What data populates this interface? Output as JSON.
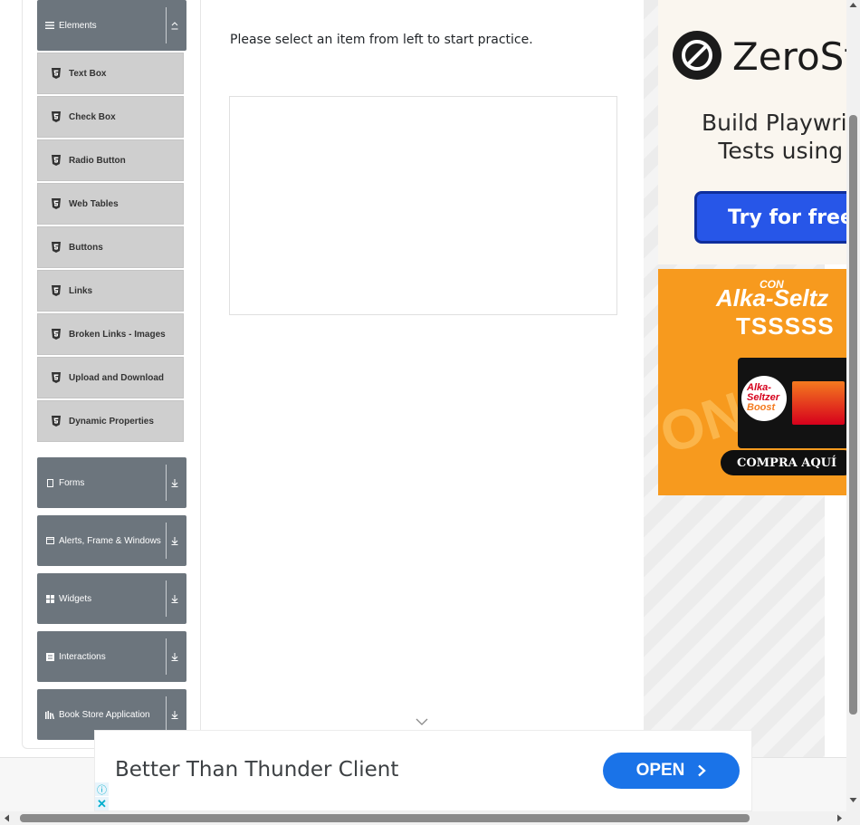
{
  "sidebar": {
    "elements_group": {
      "label": "Elements",
      "icon": "hamburger-icon",
      "arrow": "collapse-arrow-icon"
    },
    "items": [
      {
        "label": "Text Box",
        "icon": "html5-icon"
      },
      {
        "label": "Check Box",
        "icon": "html5-icon"
      },
      {
        "label": "Radio Button",
        "icon": "html5-icon"
      },
      {
        "label": "Web Tables",
        "icon": "html5-icon"
      },
      {
        "label": "Buttons",
        "icon": "html5-icon"
      },
      {
        "label": "Links",
        "icon": "html5-icon"
      },
      {
        "label": "Broken Links - Images",
        "icon": "html5-icon"
      },
      {
        "label": "Upload and Download",
        "icon": "html5-icon"
      },
      {
        "label": "Dynamic Properties",
        "icon": "html5-icon"
      }
    ],
    "groups": [
      {
        "label": "Forms",
        "icon": "document-icon"
      },
      {
        "label": "Alerts, Frame & Windows",
        "icon": "window-icon"
      },
      {
        "label": "Widgets",
        "icon": "grid-icon"
      },
      {
        "label": "Interactions",
        "icon": "square-list-icon"
      },
      {
        "label": "Book Store Application",
        "icon": "books-icon"
      }
    ]
  },
  "main": {
    "message": "Please select an item from left to start practice."
  },
  "ads": {
    "zerostep": {
      "brand": "ZeroSt",
      "tagline_1": "Build Playwri",
      "tagline_2": "Tests using",
      "button": "Try for free -"
    },
    "alka": {
      "con": "CON",
      "brand": "Alka-Seltz",
      "sound": "TSSSSS",
      "bg_text": "ON AL",
      "box_text_1": "Alka-",
      "box_text_2": "Seltzer",
      "box_text_3": "Boost",
      "cta": "COMPRA AQUÍ"
    },
    "bottom": {
      "title": "Better Than Thunder Client",
      "button": "OPEN",
      "info": "ⓘ",
      "close": "✕"
    }
  },
  "colors": {
    "sidebar_group_bg": "#6c757d",
    "menu_item_bg": "#cfcfcf",
    "ad_button_blue": "#1a73e8",
    "zerostep_button": "#2756e8",
    "alka_orange": "#f79a1e"
  }
}
